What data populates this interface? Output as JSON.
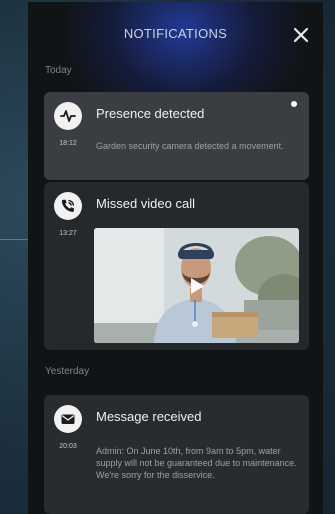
{
  "header": {
    "title": "NOTIFICATIONS",
    "close_icon": "close-icon"
  },
  "sections": {
    "today_label": "Today",
    "yesterday_label": "Yesterday"
  },
  "notifications": {
    "presence": {
      "icon": "activity-pulse-icon",
      "time": "18:12",
      "title": "Presence detected",
      "body": "Garden security camera detected a movement.",
      "unread": true
    },
    "missed_call": {
      "icon": "phone-call-icon",
      "time": "13:27",
      "title": "Missed video call",
      "media": "video-thumbnail",
      "play_icon": "play-icon"
    },
    "message": {
      "icon": "envelope-icon",
      "time": "20:03",
      "title": "Message received",
      "body": "Admin: On June 10th, from 9am to 5pm, water supply will not be guaranteed due to maintenance. We're sorry for the disservice."
    }
  },
  "colors": {
    "panel_background": "#111417",
    "header_glow": "#2846be",
    "card_highlight": "#3a3d41",
    "card_default": "#26292c",
    "text_primary": "#eef0f2",
    "text_secondary": "#9ba1a7"
  }
}
